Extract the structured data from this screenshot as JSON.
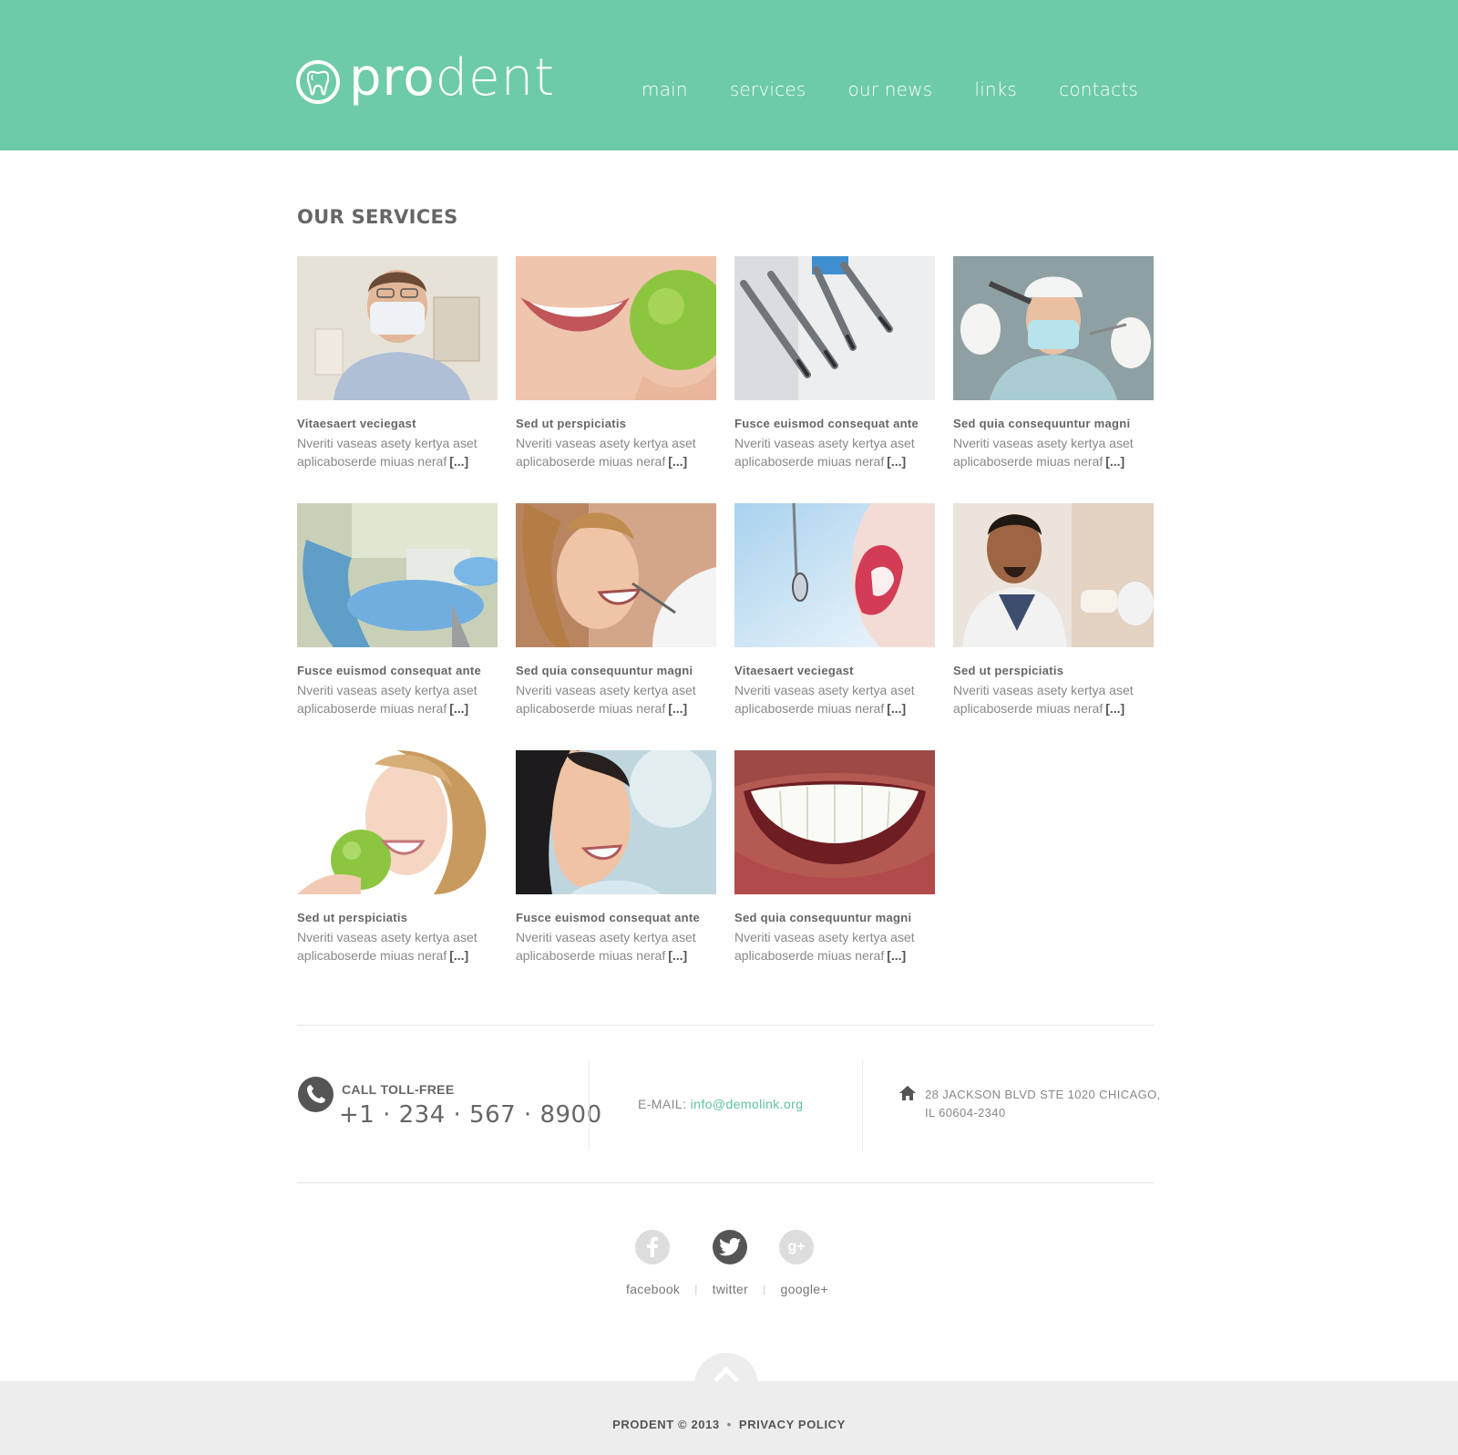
{
  "header": {
    "logo_bold": "pro",
    "logo_light": "dent",
    "nav": [
      "main",
      "services",
      "our news",
      "links",
      "contacts"
    ]
  },
  "services": {
    "title": "OUR SERVICES",
    "more": "[...]",
    "items": [
      {
        "title": "Vitaesaert veciegast",
        "text": "Nveriti vaseas asety kertya aset aplicaboserde miuas neraf",
        "photo": "dentist-with-mask"
      },
      {
        "title": "Sed ut perspiciatis",
        "text": "Nveriti vaseas asety kertya aset aplicaboserde miuas neraf",
        "photo": "smile-green-apple"
      },
      {
        "title": "Fusce euismod consequat ante",
        "text": "Nveriti vaseas asety kertya aset aplicaboserde miuas neraf",
        "photo": "dental-drills"
      },
      {
        "title": "Sed quia consequuntur magni",
        "text": "Nveriti vaseas asety kertya aset aplicaboserde miuas neraf",
        "photo": "dentist-with-tools"
      },
      {
        "title": "Fusce euismod consequat ante",
        "text": "Nveriti vaseas asety kertya aset aplicaboserde miuas neraf",
        "photo": "dental-chair"
      },
      {
        "title": "Sed quia consequuntur magni",
        "text": "Nveriti vaseas asety kertya aset aplicaboserde miuas neraf",
        "photo": "patient-checkup"
      },
      {
        "title": "Vitaesaert veciegast",
        "text": "Nveriti vaseas asety kertya aset aplicaboserde miuas neraf",
        "photo": "mouth-mirror"
      },
      {
        "title": "Sed ut perspiciatis",
        "text": "Nveriti vaseas asety kertya aset aplicaboserde miuas neraf",
        "photo": "dentist-holding-dentures"
      },
      {
        "title": "Sed ut perspiciatis",
        "text": "Nveriti vaseas asety kertya aset aplicaboserde miuas neraf",
        "photo": "woman-biting-apple"
      },
      {
        "title": "Fusce euismod consequat ante",
        "text": "Nveriti vaseas asety kertya aset aplicaboserde miuas neraf",
        "photo": "smiling-patient"
      },
      {
        "title": "Sed quia consequuntur magni",
        "text": "Nveriti vaseas asety kertya aset aplicaboserde miuas neraf",
        "photo": "white-teeth-smile"
      }
    ]
  },
  "contact": {
    "call_label": "CALL TOLL-FREE",
    "call_number": "+1 · 234 · 567 · 8900",
    "email_label": "E-MAIL:",
    "email": "info@demolink.org",
    "address": "28 JACKSON BLVD STE 1020 CHICAGO, IL 60604-2340"
  },
  "social": {
    "facebook": "facebook",
    "twitter": "twitter",
    "google": "google+",
    "sep": "|"
  },
  "footer": {
    "copyright": "PRODENT © 2013",
    "dot": "•",
    "privacy": "PRIVACY POLICY"
  },
  "colors": {
    "brand": "#6dcba7",
    "email_link": "#5fc39b",
    "footer_bg": "#ededed"
  }
}
